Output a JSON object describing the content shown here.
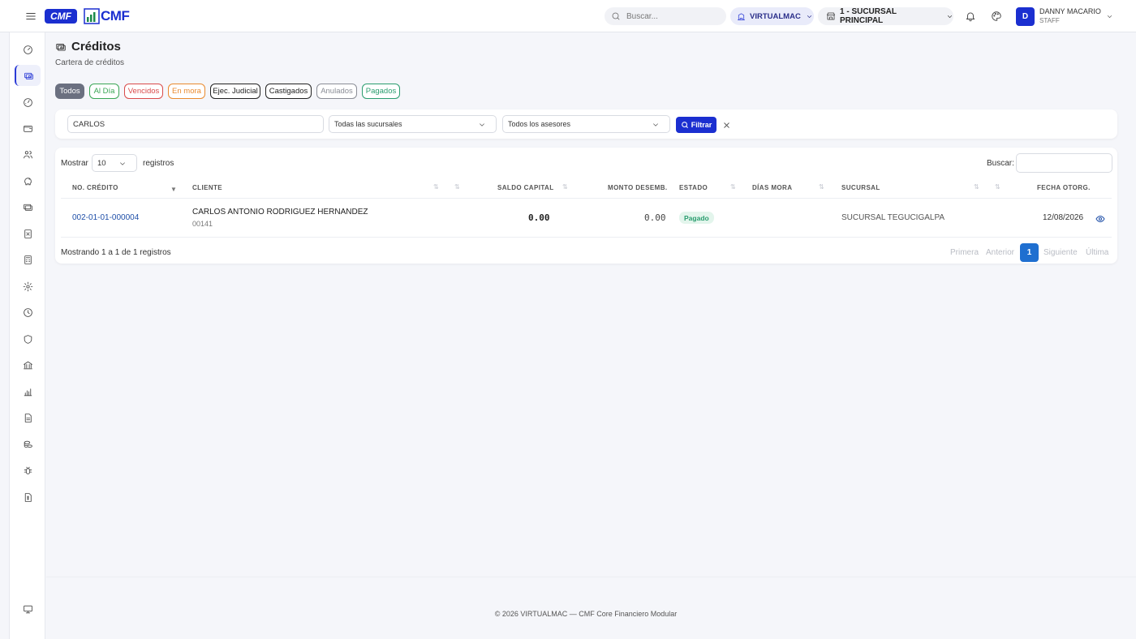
{
  "header": {
    "logo_text": "CMF",
    "brand_logo_text": "CMF",
    "search_placeholder": "Buscar...",
    "company": "VIRTUALMAC",
    "branch": "1 - SUCURSAL PRINCIPAL",
    "user_initial": "D",
    "user_name": "DANNY MACARIO",
    "user_role": "STAFF"
  },
  "page": {
    "title": "Créditos",
    "subtitle": "Cartera de créditos"
  },
  "filters": {
    "tabs": [
      {
        "label": "Todos",
        "color": "#6b7080"
      },
      {
        "label": "Al Día",
        "color": "#3aa655"
      },
      {
        "label": "Vencidos",
        "color": "#d94a4a"
      },
      {
        "label": "En mora",
        "color": "#e98a2e"
      },
      {
        "label": "Ejec. Judicial",
        "color": "#222222"
      },
      {
        "label": "Castigados",
        "color": "#222222"
      },
      {
        "label": "Anulados",
        "color": "#8a8d96"
      },
      {
        "label": "Pagados",
        "color": "#2a9d6f"
      }
    ],
    "search_value": "CARLOS",
    "branch_select": "Todas las sucursales",
    "advisor_select": "Todos los asesores",
    "filter_button": "Filtrar"
  },
  "table": {
    "show_label": "Mostrar",
    "page_size": "10",
    "records_label": "registros",
    "search_label": "Buscar:",
    "columns": [
      "NO. CRÉDITO",
      "CLIENTE",
      "SALDO CAPITAL",
      "MONTO DESEMB.",
      "ESTADO",
      "DÍAS MORA",
      "SUCURSAL",
      "FECHA OTORG."
    ],
    "rows": [
      {
        "credit_no": "002-01-01-000004",
        "client_name": "CARLOS ANTONIO RODRIGUEZ HERNANDEZ",
        "client_code": "00141",
        "saldo": "0.00",
        "monto": "0.00",
        "estado": "Pagado",
        "dias_mora": "",
        "sucursal": "SUCURSAL TEGUCIGALPA",
        "fecha": "12/08/2026"
      }
    ],
    "info": "Mostrando 1 a 1 de 1 registros",
    "pagination": {
      "first": "Primera",
      "prev": "Anterior",
      "current": "1",
      "next": "Siguiente",
      "last": "Última"
    }
  },
  "footer": {
    "text": "© 2026 VIRTUALMAC — CMF Core Financiero Modular"
  },
  "colors": {
    "primary": "#2b3bd6",
    "link": "#1f4fa8",
    "success_bg": "#e3f5ec",
    "success_text": "#2a9d6f"
  }
}
